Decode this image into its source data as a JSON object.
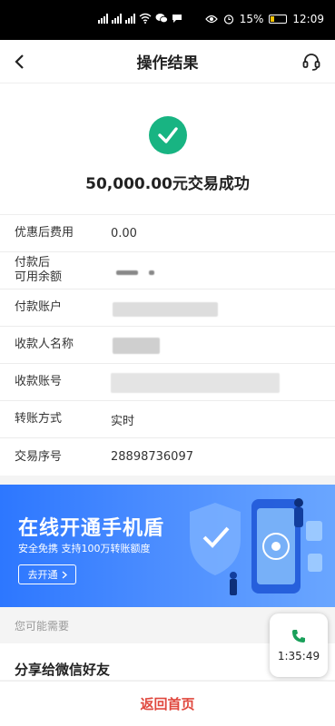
{
  "status_bar": {
    "battery": "15%",
    "time": "12:09"
  },
  "nav": {
    "title": "操作结果"
  },
  "result": {
    "text": "50,000.00元交易成功"
  },
  "details": [
    {
      "label": "优惠后费用",
      "value": "0.00"
    },
    {
      "label": "付款后\n可用余额",
      "value": ""
    },
    {
      "label": "付款账户",
      "value": ""
    },
    {
      "label": "收款人名称",
      "value": ""
    },
    {
      "label": "收款账号",
      "value": ""
    },
    {
      "label": "转账方式",
      "value": "实时"
    },
    {
      "label": "交易序号",
      "value": "28898736097"
    }
  ],
  "banner": {
    "title": "在线开通手机盾",
    "subtitle": "安全免携 支持100万转账额度",
    "button": "去开通"
  },
  "section": {
    "heading": "您可能需要",
    "share_label": "分享给微信好友"
  },
  "call": {
    "time": "1:35:49"
  },
  "bottom": {
    "home_button": "返回首页"
  },
  "colors": {
    "success": "#18b482",
    "accent": "#e0483e",
    "banner": "#2d77ff"
  }
}
